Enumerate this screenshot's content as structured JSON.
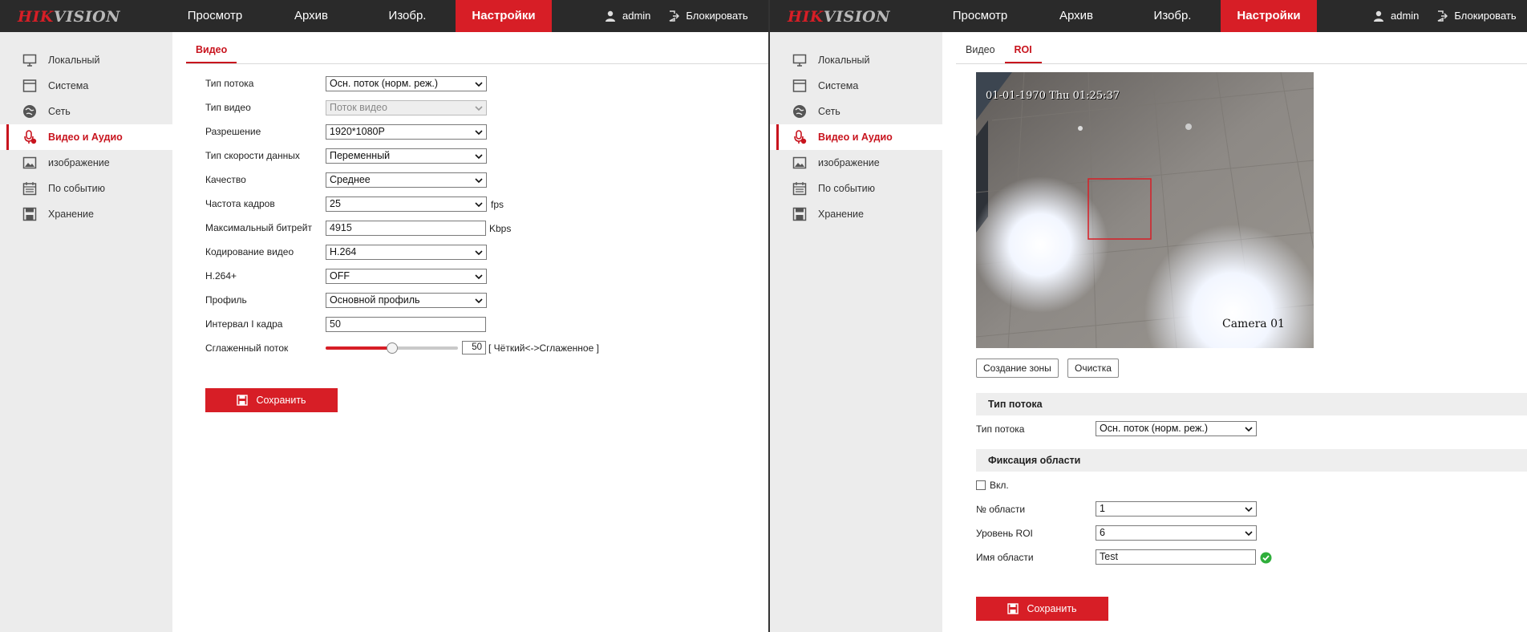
{
  "brand": {
    "logo_red": "HIK",
    "logo_grey": "VISION"
  },
  "left": {
    "nav": [
      "Просмотр",
      "Архив",
      "Изобр.",
      "Настройки"
    ],
    "user": "admin",
    "lock": "Блокировать",
    "sidebar": [
      "Локальный",
      "Система",
      "Сеть",
      "Видео и Аудио",
      "изображение",
      "По событию",
      "Хранение"
    ],
    "tabs": [
      "Видео"
    ],
    "form": {
      "stream_type": {
        "label": "Тип потока",
        "value": "Осн. поток (норм. реж.)"
      },
      "video_type": {
        "label": "Тип видео",
        "value": "Поток видео"
      },
      "resolution": {
        "label": "Разрешение",
        "value": "1920*1080P"
      },
      "bitrate_type": {
        "label": "Тип скорости данных",
        "value": "Переменный"
      },
      "quality": {
        "label": "Качество",
        "value": "Среднее"
      },
      "frame_rate": {
        "label": "Частота кадров",
        "value": "25",
        "unit": "fps"
      },
      "max_bitrate": {
        "label": "Максимальный битрейт",
        "value": "4915",
        "unit": "Kbps"
      },
      "encoding": {
        "label": "Кодирование видео",
        "value": "H.264"
      },
      "h264plus": {
        "label": "H.264+",
        "value": "OFF"
      },
      "profile": {
        "label": "Профиль",
        "value": "Основной профиль"
      },
      "i_frame": {
        "label": "Интервал I кадра",
        "value": "50"
      },
      "smoothing": {
        "label": "Сглаженный поток",
        "value": "50",
        "hint": "[ Чёткий<->Сглаженное ]",
        "level": 0.5
      }
    },
    "save": "Сохранить"
  },
  "right": {
    "nav": [
      "Просмотр",
      "Архив",
      "Изобр.",
      "Настройки"
    ],
    "user": "admin",
    "lock": "Блокировать",
    "sidebar": [
      "Локальный",
      "Система",
      "Сеть",
      "Видео и Аудио",
      "изображение",
      "По событию",
      "Хранение"
    ],
    "tabs": [
      "Видео",
      "ROI"
    ],
    "osd_time": "01-01-1970 Thu 01:25:37",
    "osd_name": "Camera 01",
    "draw_area": "Создание зоны",
    "clear": "Очистка",
    "stream_section": "Тип потока",
    "stream_type": {
      "label": "Тип потока",
      "value": "Осн. поток (норм. реж.)"
    },
    "region_section": "Фиксация области",
    "enable": "Вкл.",
    "region_no": {
      "label": "№ области",
      "value": "1"
    },
    "roi_level": {
      "label": "Уровень ROI",
      "value": "6"
    },
    "region_name": {
      "label": "Имя области",
      "value": "Test"
    },
    "save": "Сохранить"
  },
  "colors": {
    "accent": "#d71e26",
    "topbar": "#2a2a2a",
    "sidebar": "#ececec"
  },
  "icons": {
    "sidebar": [
      "monitor-icon",
      "system-icon",
      "network-icon",
      "microphone-icon",
      "image-icon",
      "calendar-icon",
      "storage-icon"
    ]
  }
}
